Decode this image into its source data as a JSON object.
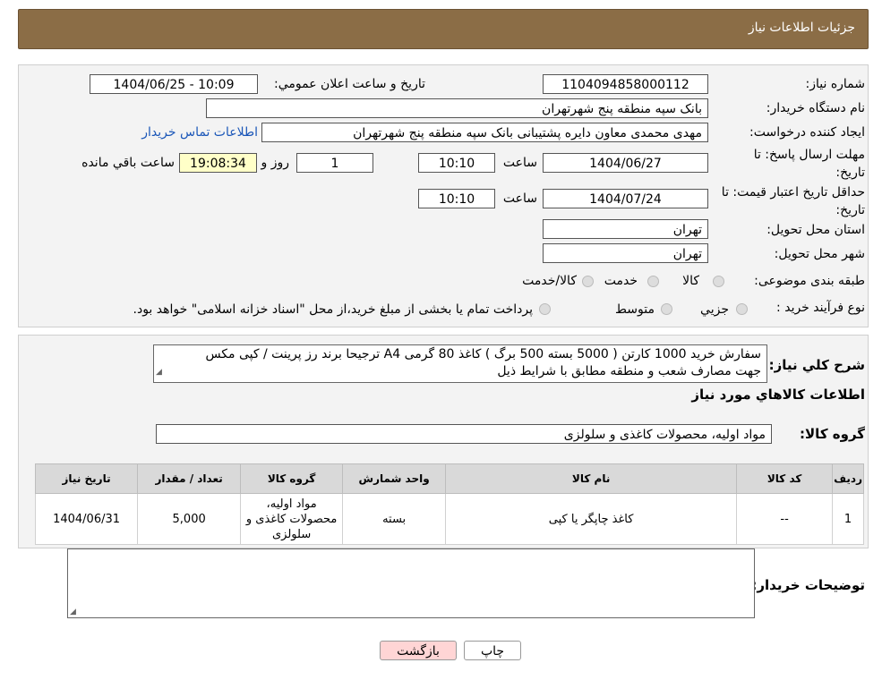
{
  "header": {
    "title": "جزئیات اطلاعات نیاز"
  },
  "form": {
    "need_number_label": "شماره نیاز:",
    "need_number": "1104094858000112",
    "announce_label": "تاريخ و ساعت اعلان عمومي:",
    "announce_value": "1404/06/25 - 10:09",
    "buyer_org_label": "نام دستگاه خريدار:",
    "buyer_org": "بانک سپه منطقه پنج شهرتهران",
    "requester_label": "ايجاد کننده درخواست:",
    "requester": "مهدی محمدی معاون دایره پشتیبانی بانک سپه منطقه پنج شهرتهران",
    "contact_link": "اطلاعات تماس خريدار",
    "deadline_label_1": "مهلت ارسال پاسخ: تا",
    "deadline_label_2": "تاریخ:",
    "deadline_date": "1404/06/27",
    "time_label": "ساعت",
    "deadline_time": "10:10",
    "days": "1",
    "days_label": "روز و",
    "remaining": "19:08:34",
    "remaining_label": "ساعت باقي مانده",
    "validity_label_1": "حداقل تاريخ اعتبار قيمت: تا",
    "validity_label_2": "تاريخ:",
    "validity_date": "1404/07/24",
    "validity_time": "10:10",
    "province_label": "استان محل تحويل:",
    "province": "تهران",
    "city_label": "شهر محل تحويل:",
    "city": "تهران",
    "category_label": "طبقه بندی موضوعی:",
    "category_options": [
      "کالا",
      "خدمت",
      "کالا/خدمت"
    ],
    "process_label": "نوع فرآيند خريد :",
    "process_options": [
      "جزيي",
      "متوسط"
    ],
    "process_note": "پرداخت تمام یا بخشی از مبلغ خرید،از محل \"اسناد خزانه اسلامی\" خواهد بود."
  },
  "description": {
    "label": "شرح کلي نياز:",
    "text_line1": "سفارش  خرید 1000 کارتن ( 5000 بسته 500 برگ ) کاغذ 80 گرمی A4 ترجیحا برند رز پرینت /  کپی مکس",
    "text_line2": "جهت مصارف شعب و منطقه مطابق با شرایط ذیل"
  },
  "goods": {
    "section_title": "اطلاعات کالاهاي مورد نياز",
    "group_label": "گروه کالا:",
    "group_value": "مواد اولیه، محصولات کاغذی و سلولزی",
    "columns": [
      "رديف",
      "کد کالا",
      "نام کالا",
      "واحد شمارش",
      "گروه کالا",
      "تعداد / مقدار",
      "تاريخ نياز"
    ],
    "rows": [
      {
        "row": "1",
        "code": "--",
        "name": "کاغذ چاپگر یا کپی",
        "unit": "بسته",
        "group": "مواد اولیه، محصولات کاغذی و سلولزی",
        "qty": "5,000",
        "date": "1404/06/31"
      }
    ]
  },
  "buyer_notes": {
    "label": "توضيحات خريدار:",
    "value": ""
  },
  "buttons": {
    "print": "چاپ",
    "back": "بازگشت"
  },
  "colors": {
    "header_bg": "#8b6d46",
    "link": "#1a56b8",
    "back_button_bg": "#ffd5d5",
    "remaining_bg": "#ffffc8"
  }
}
